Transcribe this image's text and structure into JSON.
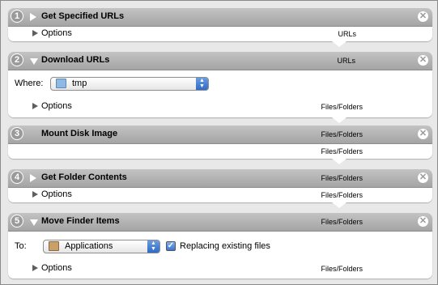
{
  "actions": [
    {
      "number": "1",
      "title": "Get Specified URLs",
      "header_type": "",
      "options_label": "Options",
      "output_type": "URLs"
    },
    {
      "number": "2",
      "title": "Download URLs",
      "header_type": "URLs",
      "field_label": "Where:",
      "popup_value": "tmp",
      "options_label": "Options",
      "output_type": "Files/Folders"
    },
    {
      "number": "3",
      "title": "Mount Disk Image",
      "header_type": "Files/Folders",
      "output_type": "Files/Folders"
    },
    {
      "number": "4",
      "title": "Get Folder Contents",
      "header_type": "Files/Folders",
      "options_label": "Options",
      "output_type": "Files/Folders"
    },
    {
      "number": "5",
      "title": "Move Finder Items",
      "header_type": "Files/Folders",
      "field_label": "To:",
      "popup_value": "Applications",
      "checkbox_label": "Replacing existing files",
      "checkbox_checked": true,
      "options_label": "Options",
      "output_type": "Files/Folders"
    }
  ],
  "icons": {
    "close": "close-x-icon",
    "disclosure": "disclosure-triangle-icon",
    "folder": "folder-icon",
    "popup_arrows": "popup-arrows-icon",
    "check": "✓"
  },
  "colors": {
    "header": "#a4a4a4",
    "number_badge": "#9a9a9a",
    "popup_accent": "#3a77cd"
  }
}
